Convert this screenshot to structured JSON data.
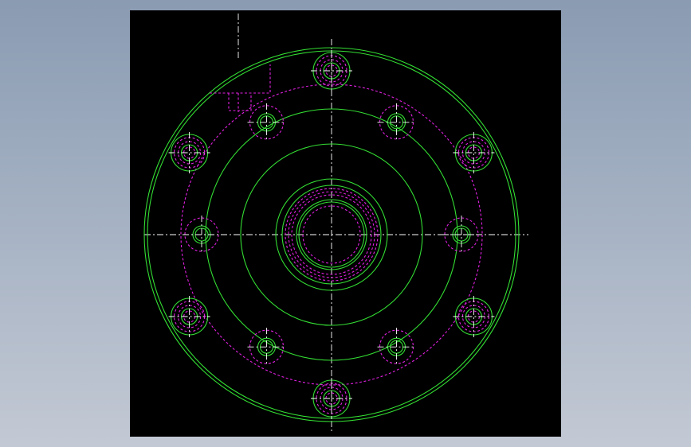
{
  "viewport": {
    "background": "#000000",
    "colors": {
      "visible_edges": "#33dd33",
      "hidden_edges": "#e020e0",
      "centerlines": "#ffffff"
    }
  },
  "part": {
    "description": "flange",
    "bolt_holes_outer": 6,
    "bolt_holes_inner": 6
  }
}
